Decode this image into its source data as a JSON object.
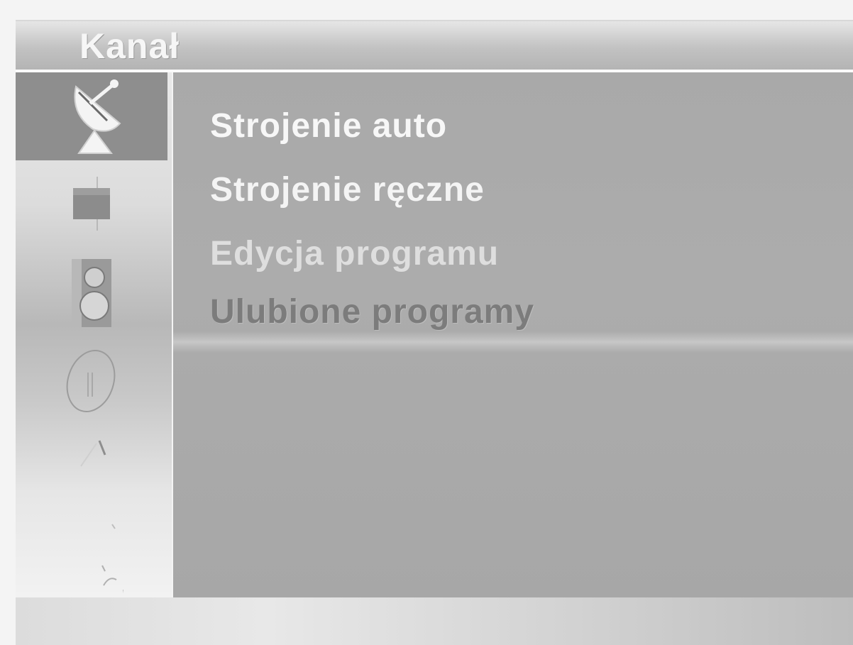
{
  "menu": {
    "title": "Kanał",
    "items": [
      {
        "label": "Strojenie auto"
      },
      {
        "label": "Strojenie ręczne"
      },
      {
        "label": "Edycja programu"
      },
      {
        "label": "Ulubione programy"
      }
    ]
  },
  "sidebar": {
    "icons": [
      {
        "name": "satellite-dish-icon",
        "active": true
      },
      {
        "name": "picture-icon",
        "active": false
      },
      {
        "name": "speaker-icon",
        "active": false
      },
      {
        "name": "clock-icon",
        "active": false
      },
      {
        "name": "lock-icon",
        "active": false
      },
      {
        "name": "settings-icon",
        "active": false
      }
    ]
  },
  "colors": {
    "active_icon_bg": "#8e8e8e",
    "content_bg": "#a9a9a9",
    "menu_text": "#f7f7f7",
    "disabled_text": "#7c7c7c"
  }
}
